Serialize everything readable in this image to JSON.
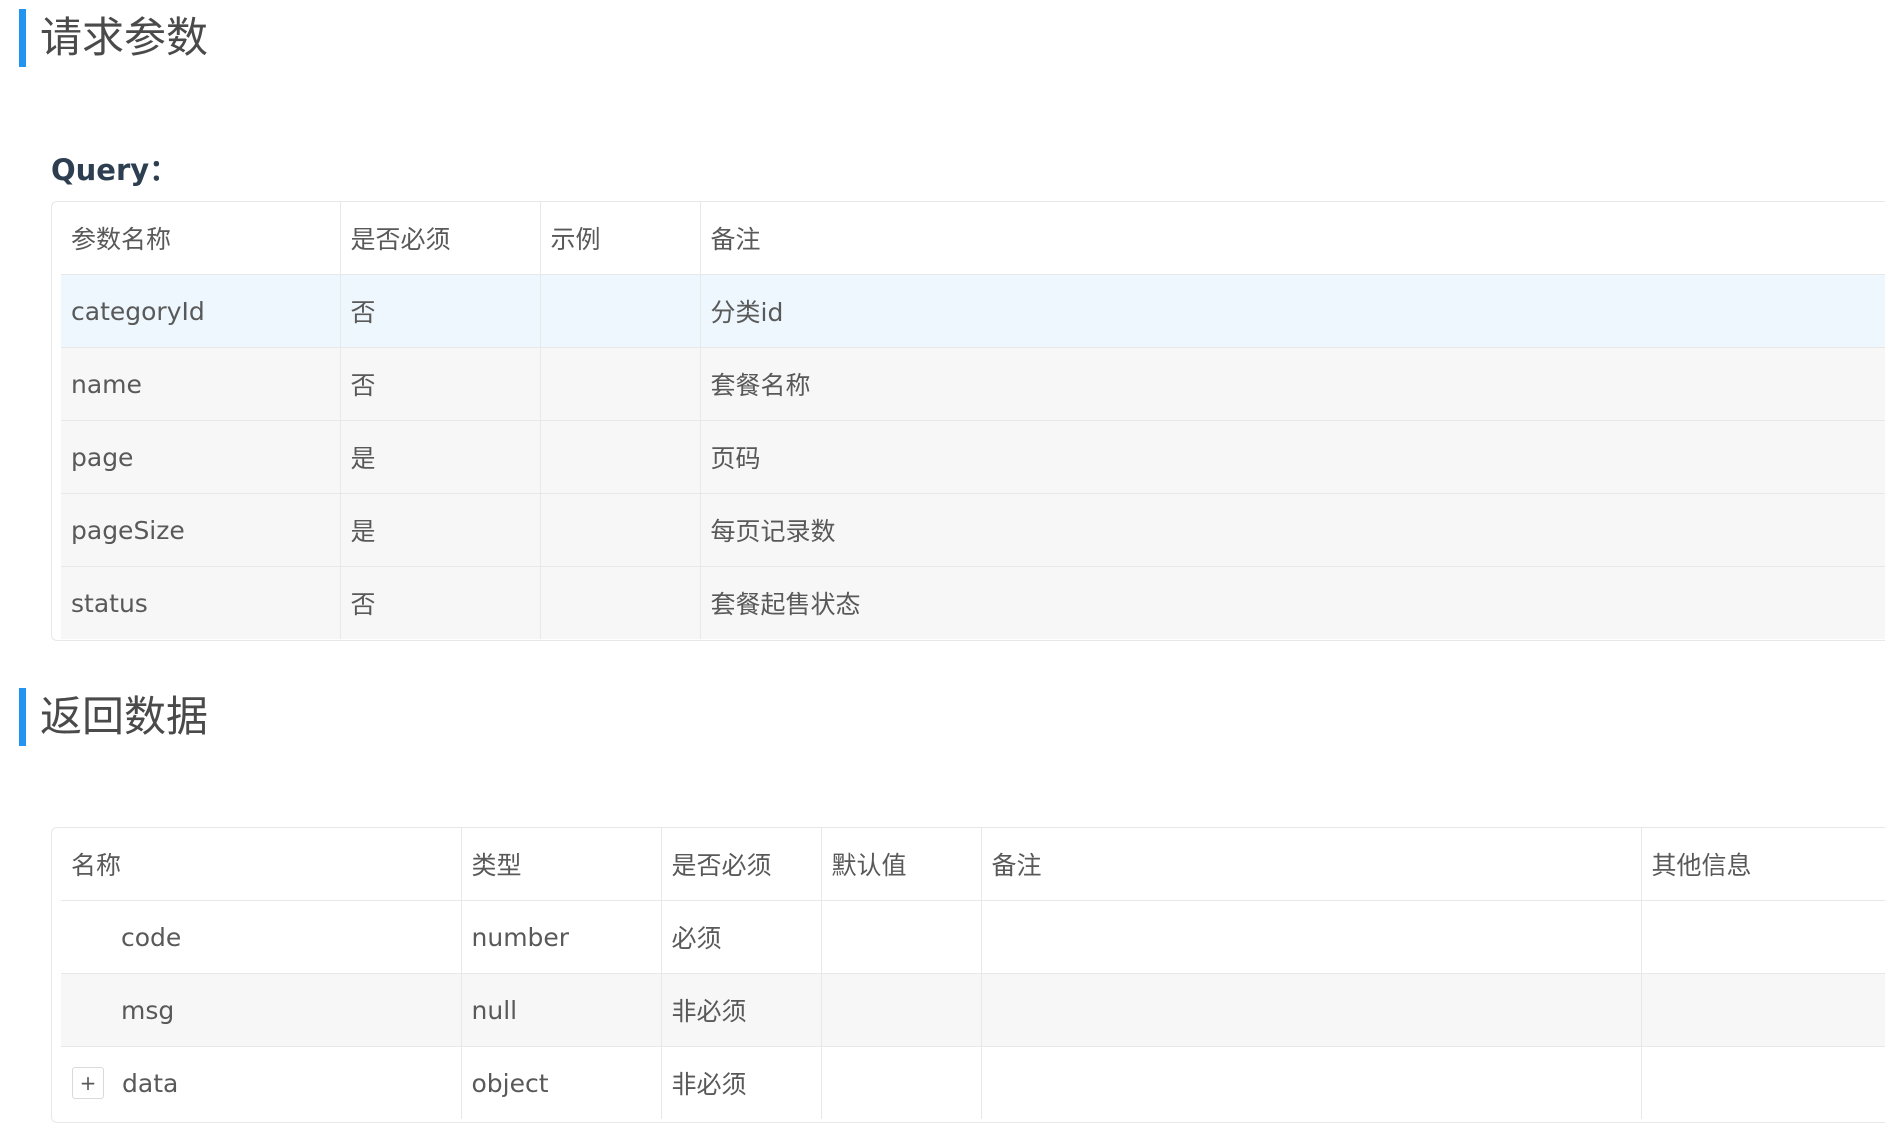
{
  "request": {
    "title": "请求参数",
    "query_label": "Query：",
    "columns": [
      "参数名称",
      "是否必须",
      "示例",
      "备注"
    ],
    "rows": [
      {
        "name": "categoryId",
        "required": "否",
        "example": "",
        "note": "分类id"
      },
      {
        "name": "name",
        "required": "否",
        "example": "",
        "note": "套餐名称"
      },
      {
        "name": "page",
        "required": "是",
        "example": "",
        "note": "页码"
      },
      {
        "name": "pageSize",
        "required": "是",
        "example": "",
        "note": "每页记录数"
      },
      {
        "name": "status",
        "required": "否",
        "example": "",
        "note": "套餐起售状态"
      }
    ]
  },
  "response": {
    "title": "返回数据",
    "columns": [
      "名称",
      "类型",
      "是否必须",
      "默认值",
      "备注",
      "其他信息"
    ],
    "rows": [
      {
        "name": "code",
        "type": "number",
        "required": "必须",
        "default": "",
        "note": "",
        "other": ""
      },
      {
        "name": "msg",
        "type": "null",
        "required": "非必须",
        "default": "",
        "note": "",
        "other": ""
      },
      {
        "name": "data",
        "type": "object",
        "required": "非必须",
        "default": "",
        "note": "",
        "other": "",
        "expand_icon": "+"
      }
    ]
  },
  "colors": {
    "accent": "#2395f1",
    "row_highlight": "#edf7fd",
    "row_stripe": "#f7f7f7",
    "border": "#e8e8e8"
  }
}
